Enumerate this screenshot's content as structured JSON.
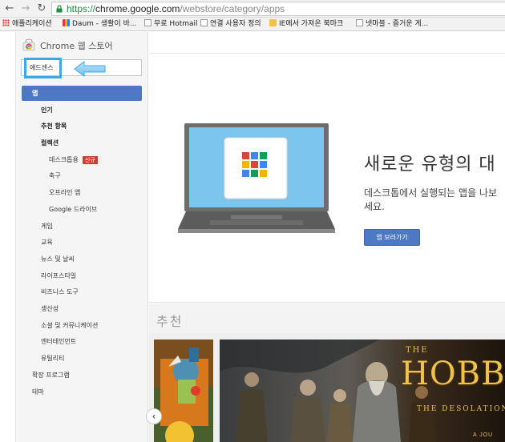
{
  "browser": {
    "url_scheme": "https://",
    "url_host": "chrome.google.com",
    "url_path": "/webstore/category/apps",
    "bookmarks": [
      "애플리케이션",
      "Daum - 생활이 바...",
      "무료 Hotmail",
      "연결 사용자 정의",
      "IE에서 가져온 북마크",
      "넷마블 - 즐거운 게..."
    ]
  },
  "store": {
    "title": "Chrome 웹 스토어",
    "search_value": "애드센스"
  },
  "sidebar": {
    "active_category": "앱",
    "items": [
      {
        "label": "인기",
        "bold": true
      },
      {
        "label": "추천 항목",
        "bold": true
      },
      {
        "label": "컬렉션",
        "bold": true
      },
      {
        "label": "데스크톱용",
        "badge": "신규"
      },
      {
        "label": "축구"
      },
      {
        "label": "오프라인 앱"
      },
      {
        "label": "Google 드라이브"
      },
      {
        "label": "게임"
      },
      {
        "label": "교육"
      },
      {
        "label": "뉴스 및 날씨"
      },
      {
        "label": "라이프스타일"
      },
      {
        "label": "비즈니스 도구"
      },
      {
        "label": "생산성"
      },
      {
        "label": "소셜 및 커뮤니케이션"
      },
      {
        "label": "엔터테인먼트"
      },
      {
        "label": "유틸리티"
      },
      {
        "label": "확장 프로그램"
      },
      {
        "label": "테마"
      }
    ]
  },
  "hero": {
    "title": "새로운 유형의 대",
    "description": "데스크톱에서 실행되는 앱을 나보세요.",
    "button_label": "앱 보러가기"
  },
  "recommended": {
    "title": "추천",
    "movie_the": "THE",
    "movie_title": "HOBBIT",
    "movie_subtitle": "THE DESOLATION",
    "movie_tag": "A JOU"
  },
  "colors": {
    "accent": "#4d78c4",
    "highlight": "#3fa6e8",
    "badge": "#d33b2c"
  }
}
